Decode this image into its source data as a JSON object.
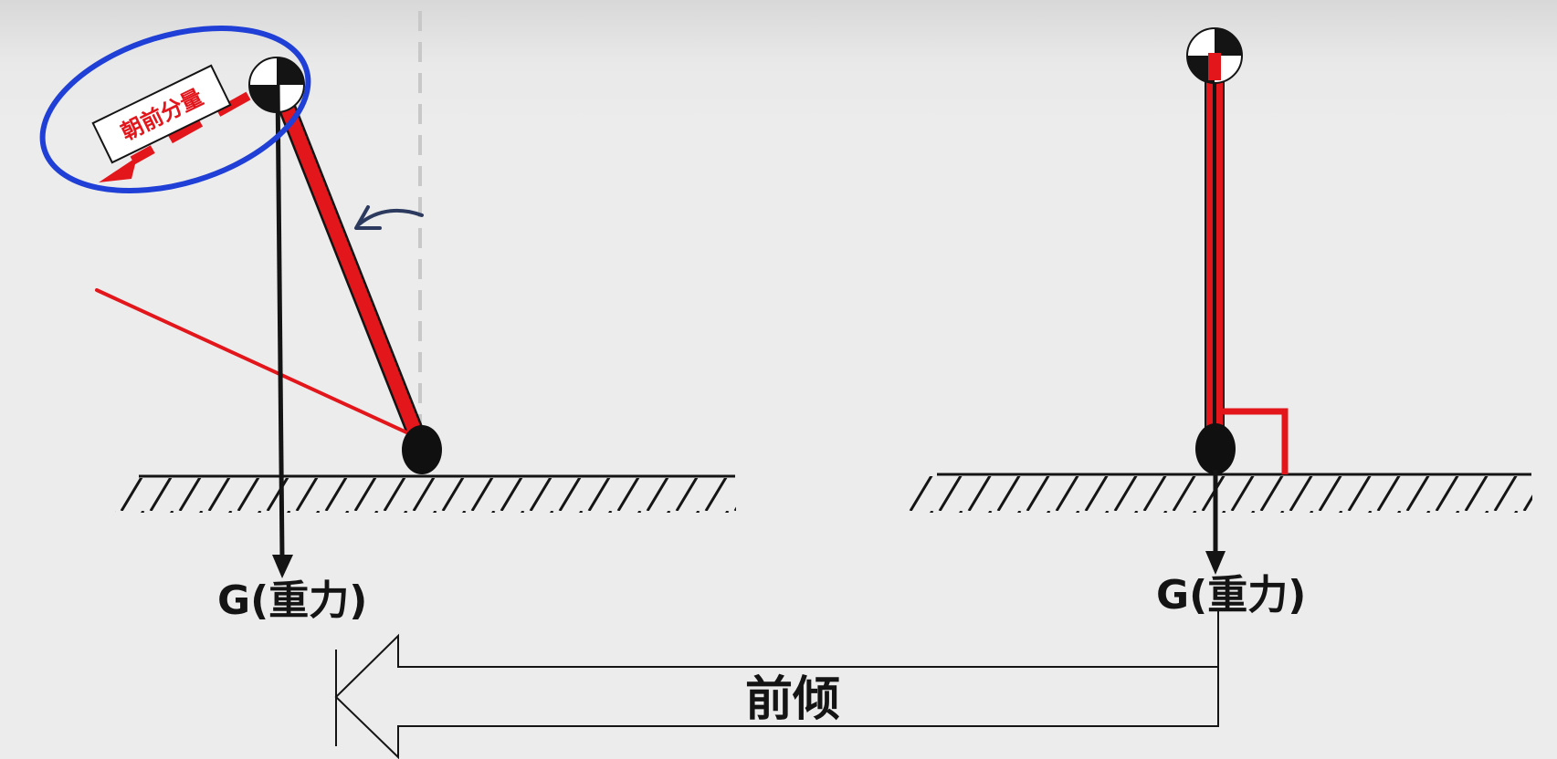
{
  "left_figure": {
    "gravity_label": "G(重力)",
    "component_label": "朝前分量"
  },
  "right_figure": {
    "gravity_label": "G(重力)"
  },
  "transition": {
    "label": "前倾"
  },
  "colors": {
    "rod": "#e3161c",
    "outline": "#141414",
    "highlight_ellipse": "#1f3fd6",
    "rotation_arrow": "#2b3a5e",
    "dashed_reference": "#c8c8c8"
  }
}
